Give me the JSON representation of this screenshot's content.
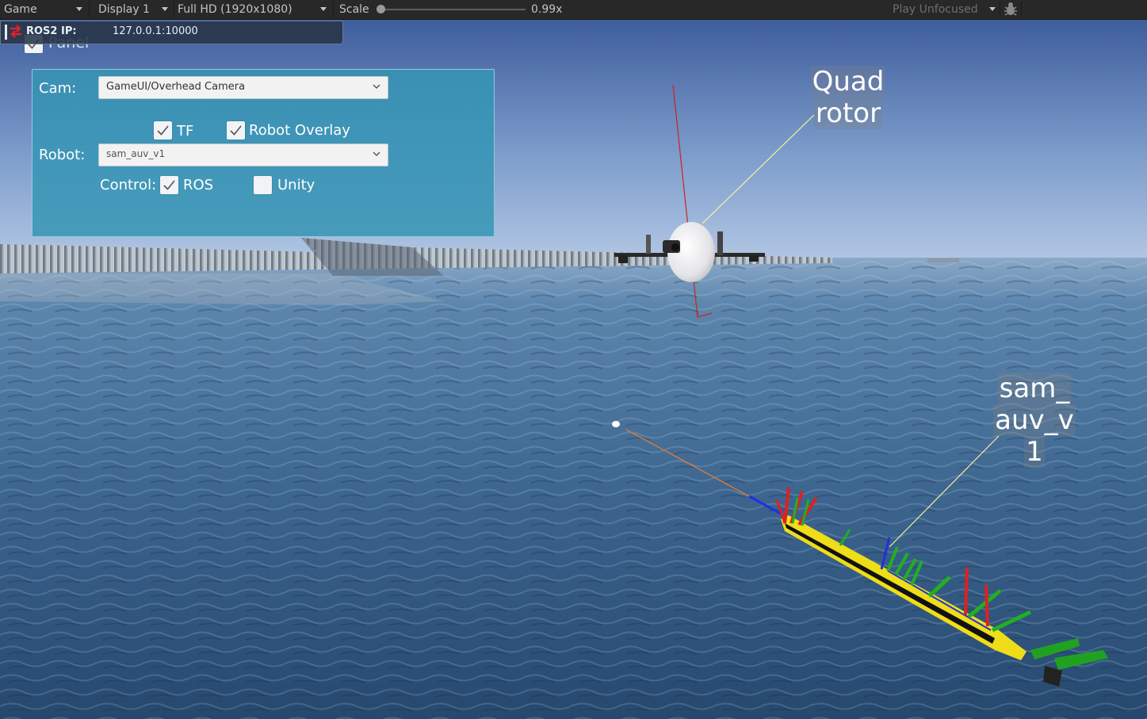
{
  "toolbar": {
    "view": "Game",
    "display": "Display 1",
    "resolution": "Full HD (1920x1080)",
    "scale_label": "Scale",
    "scale_value": "0.99x",
    "play_mode": "Play Unfocused",
    "bug_icon": "bug-icon"
  },
  "ros": {
    "label": "ROS2 IP:",
    "ip": "127.0.0.1:10000",
    "status_color": "#e0222a"
  },
  "panel_toggle": {
    "label": "Panel",
    "checked": true
  },
  "control_panel": {
    "cam_label": "Cam:",
    "cam_value": "GameUI/Overhead Camera",
    "tf_label": "TF",
    "tf_checked": true,
    "overlay_label": "Robot Overlay",
    "overlay_checked": true,
    "robot_label": "Robot:",
    "robot_value": "sam_auv_v1",
    "control_label": "Control:",
    "ros_label": "ROS",
    "ros_checked": true,
    "unity_label": "Unity",
    "unity_checked": false
  },
  "scene_labels": {
    "quadrotor_line1": "Quad",
    "quadrotor_line2": "rotor",
    "auv_line1": "sam_",
    "auv_line2": "auv_v",
    "auv_line3": "1"
  },
  "colors": {
    "panel_bg": "#3595b4",
    "auv_hull": "#f0e020",
    "axis_x": "#e02020",
    "axis_y": "#20b020",
    "axis_z": "#2030e0"
  }
}
